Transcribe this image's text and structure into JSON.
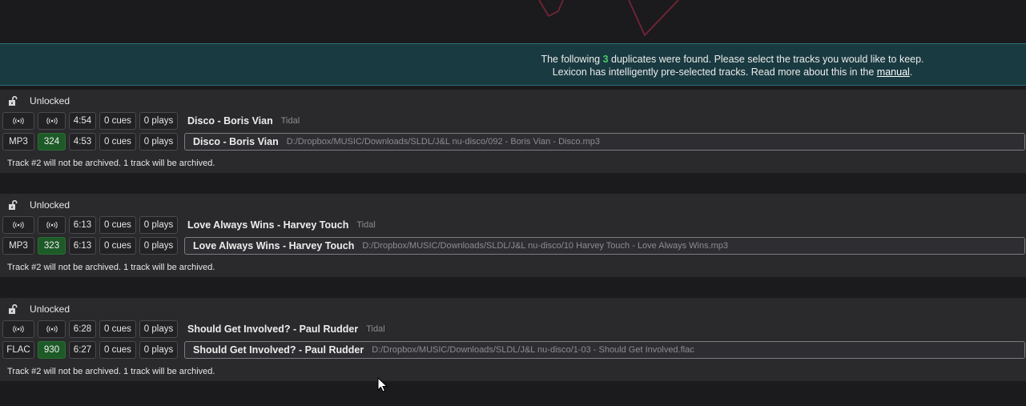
{
  "banner": {
    "line1_prefix": "The following ",
    "line1_count": "3",
    "line1_suffix": " duplicates were found. Please select the tracks you would like to keep.",
    "line2_prefix": "Lexicon has intelligently pre-selected tracks. Read more about this in the ",
    "line2_link": "manual",
    "line2_suffix": "."
  },
  "groups": [
    {
      "lock_label": "Unlocked",
      "row1": {
        "duration": "4:54",
        "cues": "0 cues",
        "plays": "0 plays",
        "title": "Disco - Boris Vian",
        "source": "Tidal"
      },
      "row2": {
        "format": "MP3",
        "bitrate": "324",
        "duration": "4:53",
        "cues": "0 cues",
        "plays": "0 plays",
        "title": "Disco - Boris Vian",
        "path": "D:/Dropbox/MUSIC/Downloads/SLDL/J&L nu-disco/092 - Boris Vian - Disco.mp3"
      },
      "note": "Track #2 will not be archived. 1 track will be archived."
    },
    {
      "lock_label": "Unlocked",
      "row1": {
        "duration": "6:13",
        "cues": "0 cues",
        "plays": "0 plays",
        "title": "Love Always Wins - Harvey Touch",
        "source": "Tidal"
      },
      "row2": {
        "format": "MP3",
        "bitrate": "323",
        "duration": "6:13",
        "cues": "0 cues",
        "plays": "0 plays",
        "title": "Love Always Wins - Harvey Touch",
        "path": "D:/Dropbox/MUSIC/Downloads/SLDL/J&L nu-disco/10 Harvey Touch - Love Always Wins.mp3"
      },
      "note": "Track #2 will not be archived. 1 track will be archived."
    },
    {
      "lock_label": "Unlocked",
      "row1": {
        "duration": "6:28",
        "cues": "0 cues",
        "plays": "0 plays",
        "title": "Should Get Involved? - Paul Rudder",
        "source": "Tidal"
      },
      "row2": {
        "format": "FLAC",
        "bitrate": "930",
        "duration": "6:27",
        "cues": "0 cues",
        "plays": "0 plays",
        "title": "Should Get Involved? - Paul Rudder",
        "path": "D:/Dropbox/MUSIC/Downloads/SLDL/J&L nu-disco/1-03 - Should Get Involved.flac"
      },
      "note": "Track #2 will not be archived. 1 track will be archived."
    }
  ],
  "icons": {
    "stream": "streaming-icon",
    "lock": "unlocked-padlock-icon",
    "cursor": "mouse-cursor-icon"
  },
  "colors": {
    "banner_bg": "#193a40",
    "bitrate_green": "#1d5a27",
    "count_green": "#4cc66a"
  }
}
